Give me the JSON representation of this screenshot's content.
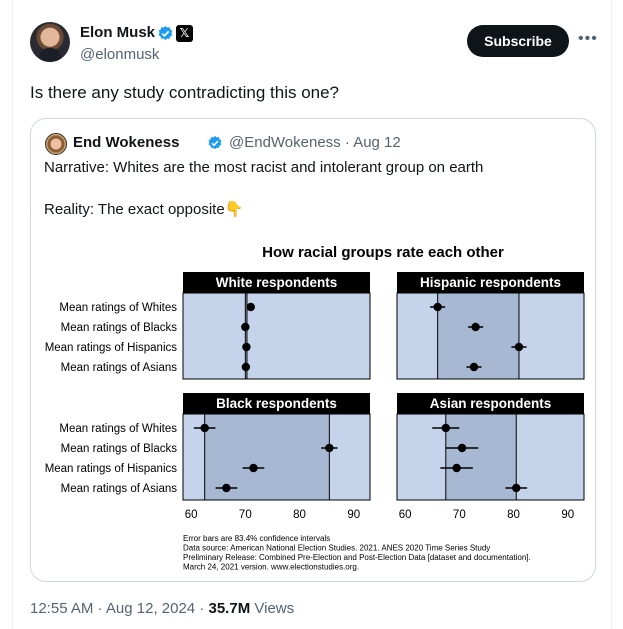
{
  "author": {
    "name": "Elon Musk",
    "handle": "@elonmusk"
  },
  "actions": {
    "subscribe_label": "Subscribe",
    "more_label": "•••"
  },
  "tweet": {
    "text": "Is there any study contradicting this one?",
    "time": "12:55 AM",
    "separator": "·",
    "date": "Aug 12, 2024",
    "views_count": "35.7M",
    "views_label": "Views"
  },
  "quote": {
    "name": "End Wokeness",
    "handle": "@EndWokeness",
    "date": "· Aug 12",
    "line1": "Narrative: Whites are the most racist and intolerant group on earth",
    "line2": "Reality: The exact opposite👇"
  },
  "colors": {
    "panel_bg": "#c5d3eb",
    "panel_shade": "#a7b9d2",
    "panel_header": "#000000",
    "verified_blue": "#1d9bf0"
  },
  "chart_data": {
    "type": "scatter",
    "title": "How racial groups rate each other",
    "row_labels": [
      "Mean ratings of Whites",
      "Mean ratings of Blacks",
      "Mean ratings of Hispanics",
      "Mean ratings of Asians"
    ],
    "x_ticks": [
      60,
      70,
      80,
      90
    ],
    "xlim": [
      58.5,
      93
    ],
    "panels": [
      {
        "title": "White respondents",
        "values": [
          71,
          70,
          70.2,
          70.1
        ],
        "err": [
          0.6,
          0.6,
          0.6,
          0.6
        ],
        "shade": [
          70,
          70.3
        ]
      },
      {
        "title": "Hispanic respondents",
        "values": [
          66,
          73,
          81,
          72.7
        ],
        "err": [
          1.4,
          1.4,
          1.4,
          1.4
        ],
        "shade": [
          66,
          81
        ]
      },
      {
        "title": "Black respondents",
        "values": [
          62.5,
          85.5,
          71.5,
          66.5
        ],
        "err": [
          2,
          1.5,
          2,
          2
        ],
        "shade": [
          62.5,
          85.5
        ]
      },
      {
        "title": "Asian respondents",
        "values": [
          67.5,
          70.5,
          69.5,
          80.5
        ],
        "err": [
          2.5,
          3,
          3,
          2
        ],
        "shade": [
          67.5,
          80.5
        ]
      }
    ],
    "notes": [
      "Error bars are 83.4% confidence intervals",
      "Data source: American National Election Studies. 2021. ANES 2020 Time Series Study",
      "Preliminary Release: Combined Pre-Election and Post-Election Data [dataset and documentation].",
      "March 24, 2021 version. www.electionstudies.org."
    ]
  }
}
